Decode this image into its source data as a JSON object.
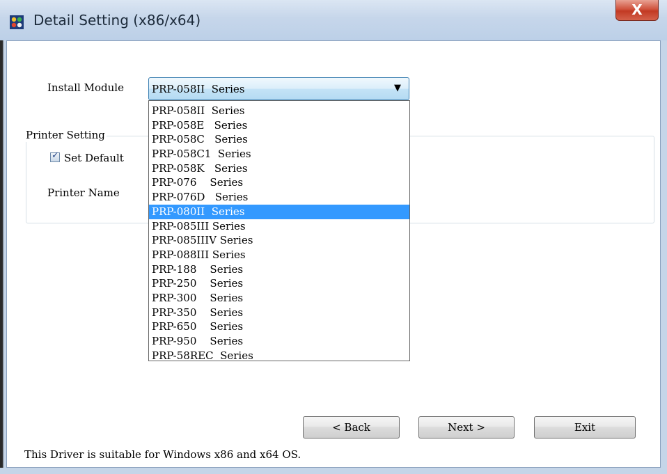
{
  "window": {
    "title": "Detail Setting (x86/x64)",
    "close_label": "X"
  },
  "install": {
    "label": "Install Module",
    "selected": "PRP-058II  Series",
    "options": [
      "PRP-058II  Series",
      "PRP-058E   Series",
      "PRP-058C   Series",
      "PRP-058C1  Series",
      "PRP-058K   Series",
      "PRP-076    Series",
      "PRP-076D   Series",
      "PRP-080II  Series",
      "PRP-085III Series",
      "PRP-085IIIV Series",
      "PRP-088III Series",
      "PRP-188    Series",
      "PRP-250    Series",
      "PRP-300    Series",
      "PRP-350    Series",
      "PRP-650    Series",
      "PRP-950    Series",
      "PRP-58REC  Series"
    ],
    "highlighted_index": 7
  },
  "printer_setting": {
    "legend": "Printer Setting",
    "set_default_label": "Set Default",
    "set_default_checked": true,
    "printer_name_label": "Printer Name"
  },
  "buttons": {
    "back": "< Back",
    "next": "Next >",
    "exit": "Exit"
  },
  "footer": {
    "text": "This Driver is suitable for Windows x86 and x64 OS."
  },
  "colors": {
    "highlight": "#3399ff",
    "close_button": "#c23a24"
  }
}
